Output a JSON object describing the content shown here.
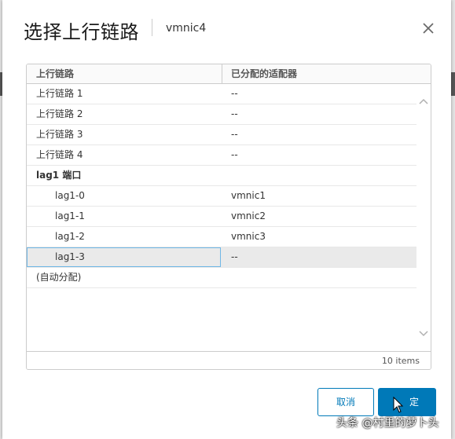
{
  "dialog": {
    "title": "选择上行链路",
    "subtitle": "vmnic4"
  },
  "grid": {
    "columns": [
      "上行链路",
      "已分配的适配器"
    ],
    "rows": [
      {
        "uplink": "上行链路 1",
        "adapter": "--"
      },
      {
        "uplink": "上行链路 2",
        "adapter": "--"
      },
      {
        "uplink": "上行链路 3",
        "adapter": "--"
      },
      {
        "uplink": "上行链路 4",
        "adapter": "--"
      },
      {
        "uplink": "lag1 端口",
        "adapter": ""
      },
      {
        "uplink": "lag1-0",
        "adapter": "vmnic1"
      },
      {
        "uplink": "lag1-1",
        "adapter": "vmnic2"
      },
      {
        "uplink": "lag1-2",
        "adapter": "vmnic3"
      },
      {
        "uplink": "lag1-3",
        "adapter": "--"
      },
      {
        "uplink": "(自动分配)",
        "adapter": ""
      }
    ],
    "footer": "10 items"
  },
  "buttons": {
    "cancel": "取消",
    "ok": "定"
  },
  "watermark": "头条 @村里的萝卜头",
  "colors": {
    "accent": "#0079b8",
    "focus_border": "#6fb7e6",
    "selected_row": "#eaeaea"
  },
  "icons": {
    "close": "close-icon",
    "scroll_up": "chevron-up-icon",
    "scroll_down": "chevron-down-icon",
    "cursor": "mouse-pointer-icon"
  }
}
